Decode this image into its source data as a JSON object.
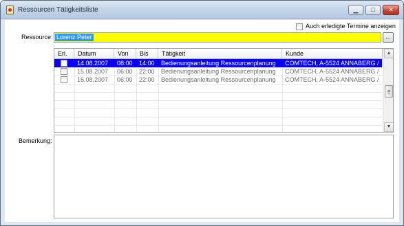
{
  "window": {
    "title": "Ressourcen Tätigkeitsliste",
    "min_symbol": "▁",
    "max_symbol": "□",
    "close_symbol": "✕"
  },
  "options": {
    "show_done_label": "Auch erledigte Termine anzeigen",
    "show_done_checked": false
  },
  "resource": {
    "label": "Ressource:",
    "value": "Lorenz Peter",
    "field_color": "#ffff00",
    "browse_label": "..."
  },
  "grid": {
    "columns": [
      "Erl.",
      "Datum",
      "Von",
      "Bis",
      "Tätigkeit",
      "Kunde"
    ],
    "rows": [
      {
        "done": false,
        "date": "14.08.2007",
        "from": "08:00",
        "to": "14:00",
        "activity": "Bedienungsanleitung Ressourcenplanung",
        "customer": "COMTECH, A-5524 ANNABERG /",
        "selected": true
      },
      {
        "done": false,
        "date": "15.08.2007",
        "from": "06:00",
        "to": "22:00",
        "activity": "Bedienungsanleitung Ressourcenplanung",
        "customer": "COMTECH, A-5524 ANNABERG /",
        "selected": false
      },
      {
        "done": false,
        "date": "16.08.2007",
        "from": "06:00",
        "to": "22:00",
        "activity": "Bedienungsanleitung Ressourcenplanung",
        "customer": "COMTECH, A-5524 ANNABERG /",
        "selected": false
      }
    ],
    "selection_color": "#0a00ff"
  },
  "remark": {
    "label": "Bemerkung:",
    "value": ""
  },
  "icons": {
    "app": "app-icon",
    "scroll_up": "▲",
    "scroll_down": "▼"
  }
}
